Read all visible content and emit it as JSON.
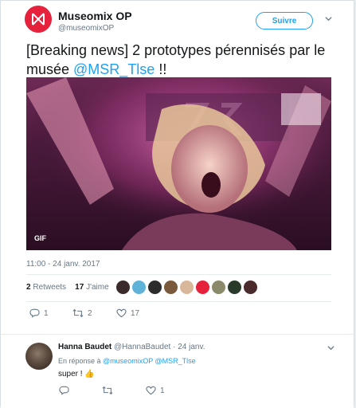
{
  "tweet": {
    "author_name": "Museomix OP",
    "author_handle": "@museomixOP",
    "follow_label": "Suivre",
    "text_prefix": "[Breaking news]  2 prototypes pérennisés par le musée ",
    "text_mention": "@MSR_Tlse",
    "text_suffix": " !!",
    "media_badge": "GIF",
    "timestamp": "11:00 - 24 janv. 2017",
    "retweets_count": "2",
    "retweets_label": "Retweets",
    "likes_count": "17",
    "likes_label": "J'aime",
    "actions": {
      "reply_count": "1",
      "retweet_count": "2",
      "like_count": "17"
    }
  },
  "reply": {
    "author_name": "Hanna Baudet",
    "author_handle_date": "@HannaBaudet · 24 janv.",
    "reply_to_prefix": "En réponse à ",
    "reply_to_users": "@museomixOP @MSR_Tlse",
    "text": "super ! 👍",
    "actions": {
      "reply_count": "",
      "retweet_count": "",
      "like_count": "1"
    }
  },
  "icons": {
    "brand_logo": "museomix-logo-icon",
    "chevron": "chevron-down-icon",
    "reply": "reply-icon",
    "retweet": "retweet-icon",
    "like": "heart-icon"
  },
  "colors": {
    "brand_red": "#e5213b",
    "link_blue": "#1da1f2",
    "muted": "#657786"
  }
}
